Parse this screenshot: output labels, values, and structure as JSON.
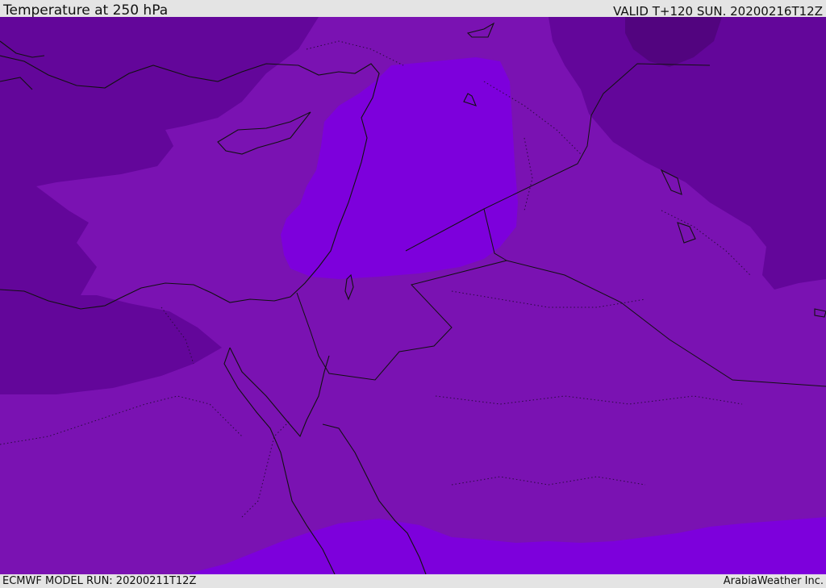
{
  "header": {
    "title": "Temperature at 250 hPa",
    "valid": "VALID T+120 SUN. 20200216T12Z"
  },
  "footer": {
    "model_run": "ECMWF MODEL RUN: 20200211T12Z",
    "brand": "ArabiaWeather Inc."
  },
  "map": {
    "colors": {
      "base_band": "#7a12b2",
      "cold_band": "#63069a",
      "coldest_band": "#52047f",
      "warm_band": "#7d00dc",
      "coast": "#111111"
    }
  }
}
